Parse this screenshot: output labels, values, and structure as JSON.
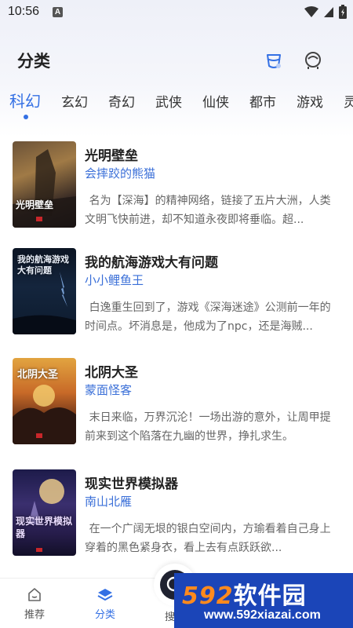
{
  "status": {
    "time": "10:56",
    "notification_letter": "A"
  },
  "header": {
    "title": "分类",
    "icons": [
      "gift-icon",
      "user-icon"
    ]
  },
  "tabs": [
    {
      "label": "科幻",
      "active": true
    },
    {
      "label": "玄幻",
      "active": false
    },
    {
      "label": "奇幻",
      "active": false
    },
    {
      "label": "武侠",
      "active": false
    },
    {
      "label": "仙侠",
      "active": false
    },
    {
      "label": "都市",
      "active": false
    },
    {
      "label": "游戏",
      "active": false
    },
    {
      "label": "灵",
      "active": false
    }
  ],
  "books": [
    {
      "title": "光明壁垒",
      "author": "会摔跤的熊猫",
      "description": "名为【深海】的精神网络，链接了五片大洲，人类文明飞快前进，却不知道永夜即将垂临。超...",
      "cover_text": "光明壁垒"
    },
    {
      "title": "我的航海游戏大有问题",
      "author": "小小鲤鱼王",
      "description": "白逸重生回到了，游戏《深海迷途》公测前一年的时间点。坏消息是，他成为了npc，还是海贼...",
      "cover_text": "我的航海游戏大有问题"
    },
    {
      "title": "北阴大圣",
      "author": "蒙面怪客",
      "description": "末日来临，万界沉沦！一场出游的意外，让周甲提前来到这个陷落在九幽的世界，挣扎求生。",
      "cover_text": "北阴大圣"
    },
    {
      "title": "现实世界模拟器",
      "author": "南山北雁",
      "description": "在一个广阔无垠的银白空间内，方瑜看着自己身上穿着的黑色紧身衣，看上去有点跃跃欲...",
      "cover_text": "现实世界模拟器"
    }
  ],
  "bottom_nav": [
    {
      "label": "推荐",
      "icon": "home-icon",
      "active": false
    },
    {
      "label": "分类",
      "icon": "layers-icon",
      "active": true
    },
    {
      "label": "搜",
      "icon": "search-icon",
      "active": false
    }
  ],
  "watermark": {
    "brand_num": "592",
    "brand_text": "软件园",
    "url": "www.592xiazai.com"
  },
  "colors": {
    "accent": "#3470e4",
    "author": "#3a6fd8",
    "desc": "#666666"
  }
}
